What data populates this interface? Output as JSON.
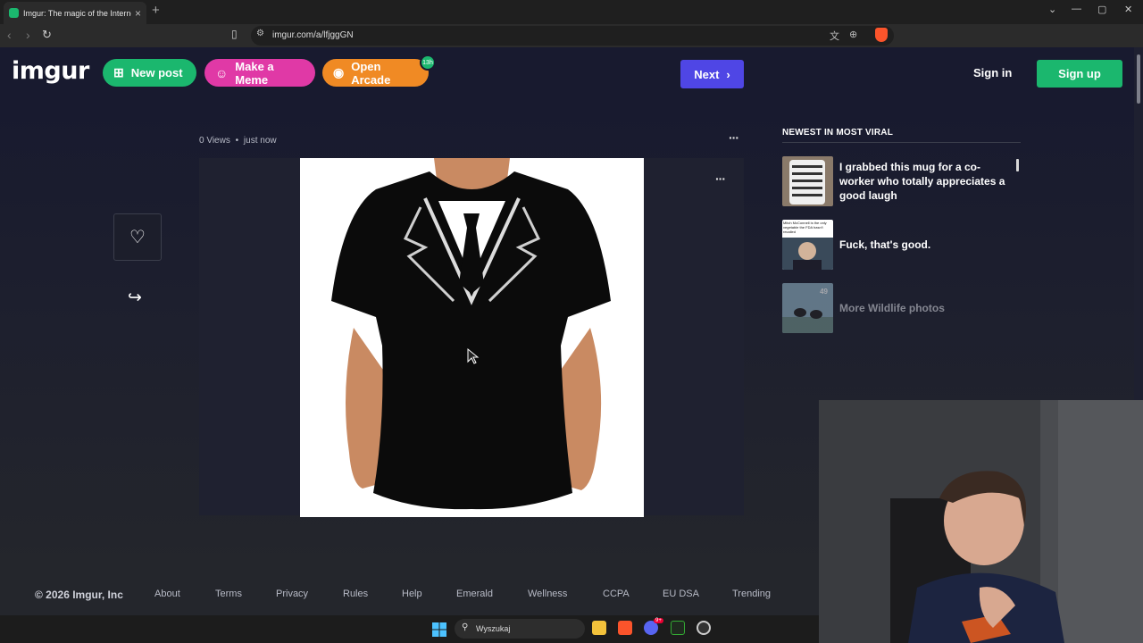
{
  "browser": {
    "tab_title": "Imgur: The magic of the Internet",
    "new_tab": "+",
    "url": "imgur.com/a/lfjggGN"
  },
  "header": {
    "logo": "imgur",
    "new_post": "New post",
    "make_meme": "Make a Meme",
    "open_arcade": "Open Arcade",
    "arcade_badge": "13h",
    "next": "Next",
    "sign_in": "Sign in",
    "sign_up": "Sign up"
  },
  "post": {
    "views": "0 Views",
    "separator": "•",
    "time": "just now"
  },
  "sidebar": {
    "heading": "NEWEST IN MOST VIRAL",
    "items": [
      {
        "title": "I grabbed this mug for a co-worker who totally appreciates a good laugh"
      },
      {
        "title": "Fuck, that's good.",
        "thumb_caption": "Mitch McConnell is the only vegetable the FDA hasn't recalled"
      },
      {
        "title": "More Wildlife photos",
        "count": "49"
      }
    ]
  },
  "footer": {
    "copyright": "© 2026 Imgur, Inc",
    "links": [
      "About",
      "Terms",
      "Privacy",
      "Rules",
      "Help",
      "Emerald",
      "Wellness",
      "CCPA",
      "EU DSA",
      "Trending"
    ]
  },
  "taskbar": {
    "search_placeholder": "Wyszukaj",
    "discord_badge": "9+"
  },
  "colors": {
    "green": "#1bb76e",
    "pink": "#e039a6",
    "orange": "#f08a24",
    "indigo": "#4f46e5",
    "header_bg": "#181a2f"
  }
}
